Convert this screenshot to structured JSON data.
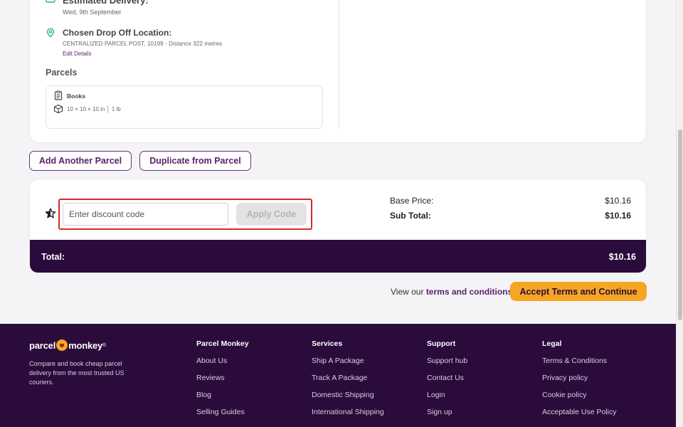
{
  "shipment": {
    "estimated_title": "Estimated Delivery:",
    "estimated_date": "Wed, 9th September",
    "dropoff_title": "Chosen Drop Off Location:",
    "dropoff_address": "CENTRALIZED PARCEL POST, 10199 - Distance 322 metres",
    "edit_link": "Edit Details"
  },
  "parcels": {
    "heading": "Parcels",
    "items": [
      {
        "name": "Books",
        "dimensions": "10 × 10 × 10 in  │  1 lb"
      }
    ]
  },
  "actions": {
    "add_parcel": "Add Another Parcel",
    "duplicate_parcel": "Duplicate from Parcel"
  },
  "discount": {
    "placeholder": "Enter discount code",
    "apply_label": "Apply Code"
  },
  "summary": {
    "base_label": "Base Price:",
    "base_value": "$10.16",
    "subtotal_label": "Sub Total:",
    "subtotal_value": "$10.16",
    "total_label": "Total:",
    "total_value": "$10.16"
  },
  "terms": {
    "prefix": "View our ",
    "link": "terms and conditions",
    "accept_label": "Accept Terms and Continue"
  },
  "footer": {
    "logo_left": "parcel",
    "logo_right": "monkey",
    "logo_mark": "®",
    "tagline": "Compare and book cheap parcel delivery from the most trusted US couriers.",
    "columns": [
      {
        "heading": "Parcel Monkey",
        "links": [
          "About Us",
          "Reviews",
          "Blog",
          "Selling Guides"
        ]
      },
      {
        "heading": "Services",
        "links": [
          "Ship A Package",
          "Track A Package",
          "Domestic Shipping",
          "International Shipping"
        ]
      },
      {
        "heading": "Support",
        "links": [
          "Support hub",
          "Contact Us",
          "Login",
          "Sign up"
        ]
      },
      {
        "heading": "Legal",
        "links": [
          "Terms & Conditions",
          "Privacy policy",
          "Cookie policy",
          "Acceptable Use Policy"
        ]
      }
    ]
  },
  "colors": {
    "brand_purple": "#2a0b3b",
    "accent_orange": "#f6a623",
    "link_purple": "#5a1f6d",
    "highlight_red": "#d42a2a"
  }
}
